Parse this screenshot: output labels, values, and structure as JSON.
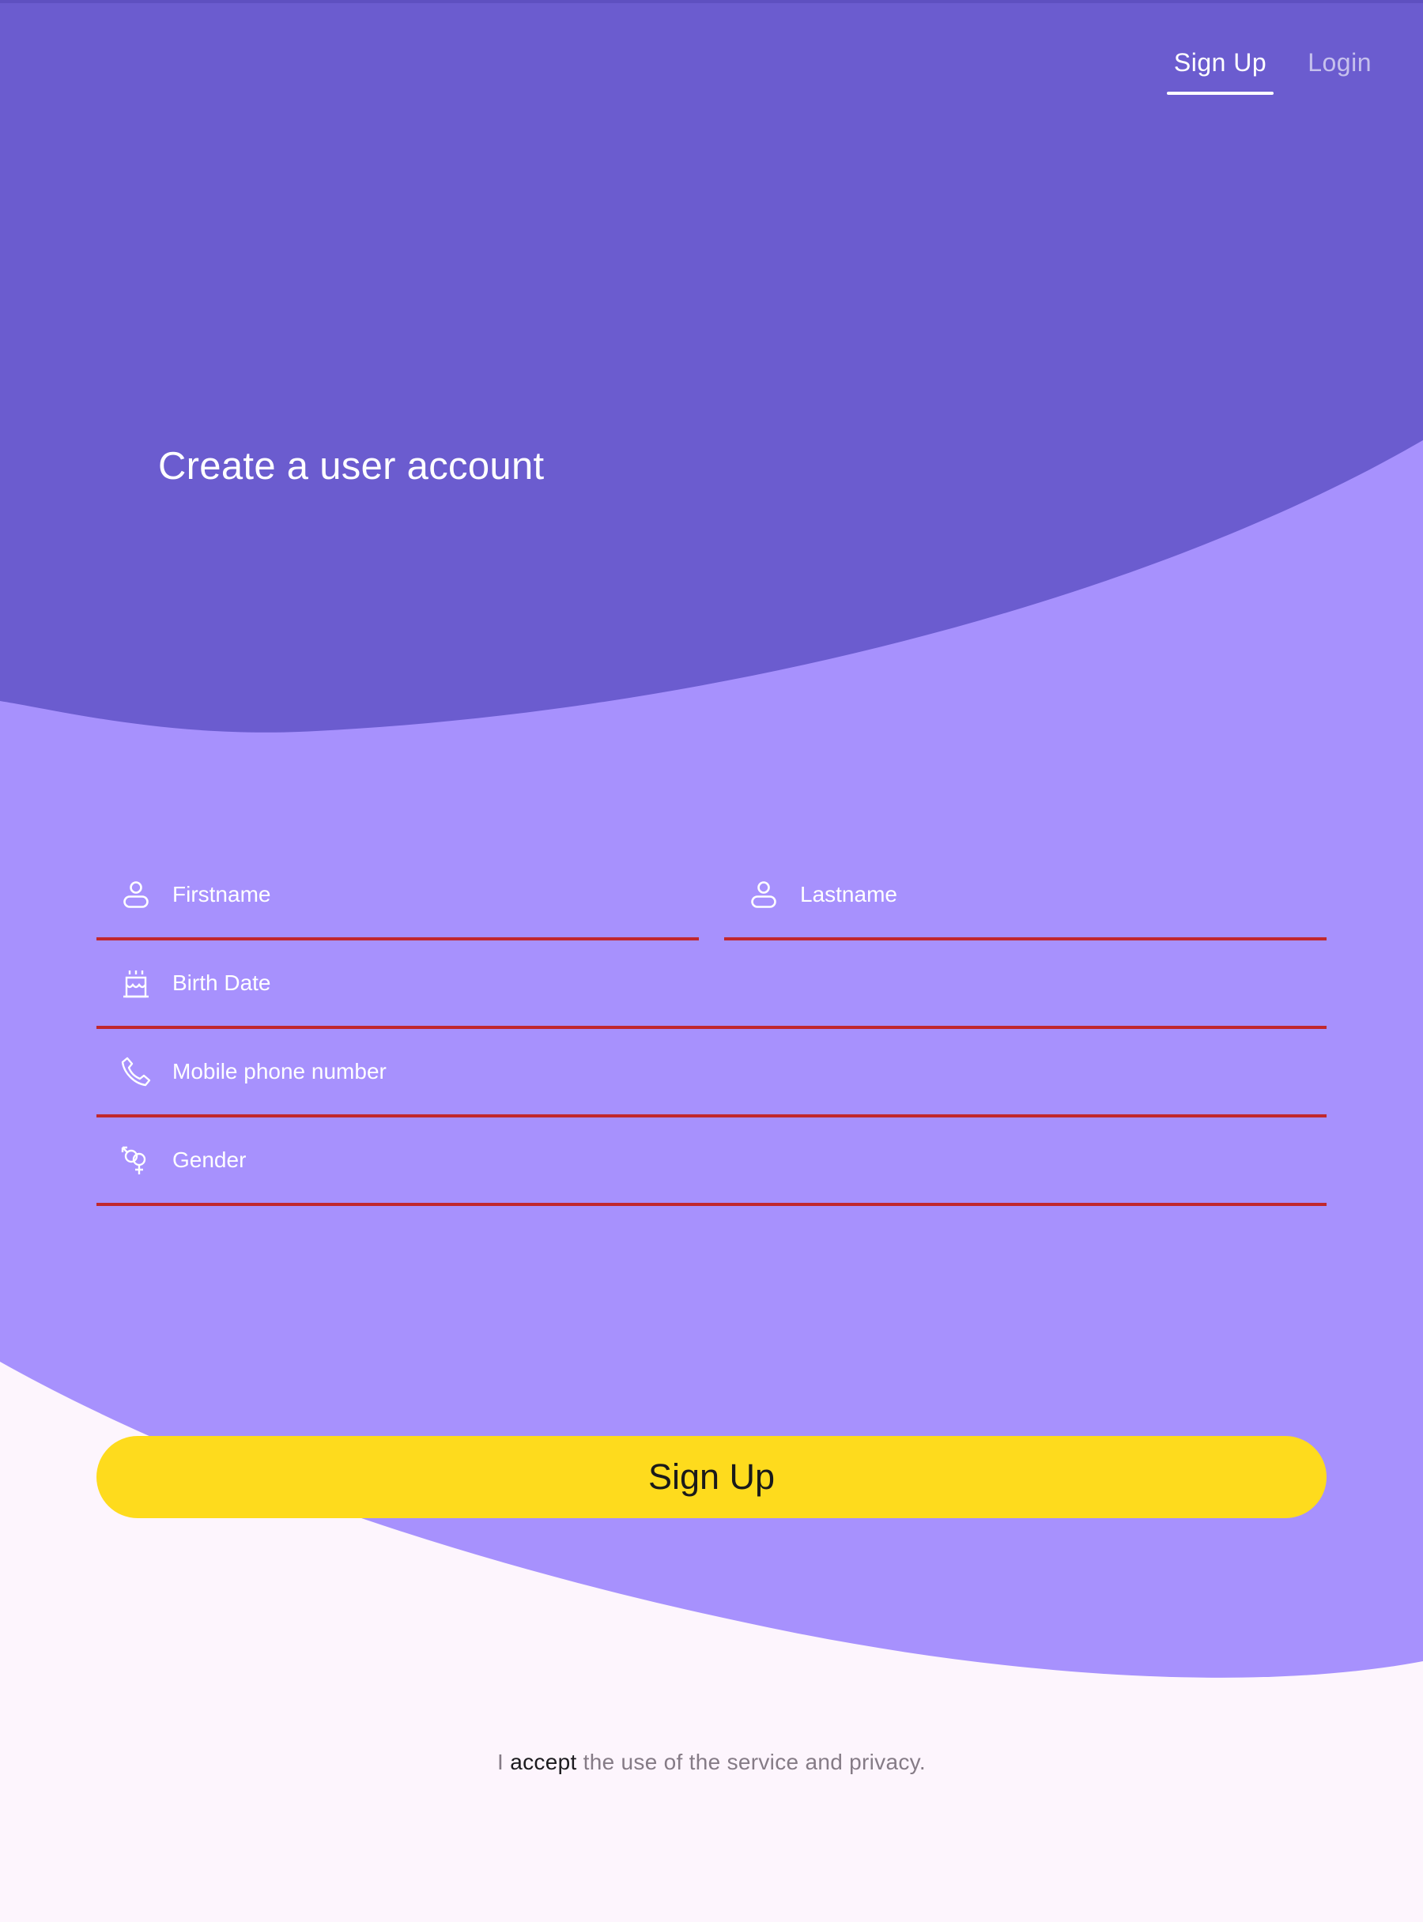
{
  "header": {
    "tabs": [
      {
        "label": "Sign Up",
        "active": true
      },
      {
        "label": "Login",
        "active": false
      }
    ]
  },
  "hero": {
    "title": "Create a user account"
  },
  "form": {
    "firstname": {
      "placeholder": "Firstname",
      "value": "",
      "icon": "person-icon"
    },
    "lastname": {
      "placeholder": "Lastname",
      "value": "",
      "icon": "person-icon"
    },
    "birthdate": {
      "placeholder": "Birth Date",
      "value": "",
      "icon": "cake-icon"
    },
    "phone": {
      "placeholder": "Mobile phone number",
      "value": "",
      "icon": "phone-icon"
    },
    "gender": {
      "placeholder": "Gender",
      "value": "",
      "icon": "gender-icon"
    }
  },
  "actions": {
    "signup_label": "Sign Up"
  },
  "footer": {
    "terms_prefix": "I",
    "terms_link": "accept",
    "terms_suffix": "the use of the service and privacy."
  },
  "colors": {
    "top_wave": "#6b5ccf",
    "mid_wave": "#a791fd",
    "background": "#fdf5fd",
    "underline": "#c1272d",
    "button": "#fedb1d"
  }
}
